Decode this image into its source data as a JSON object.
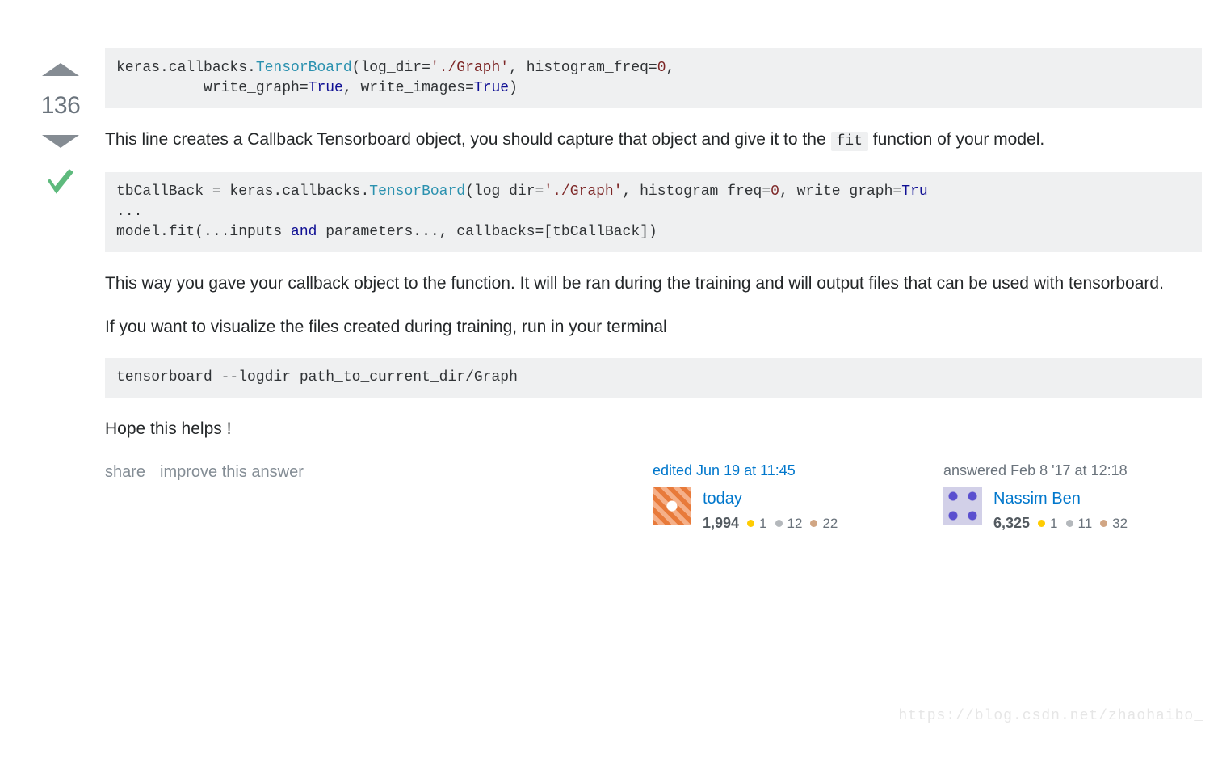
{
  "vote": {
    "count": "136"
  },
  "code": {
    "block1": {
      "prefix": "keras.callbacks.",
      "cls": "TensorBoard",
      "open": "(log_dir=",
      "str1": "'./Graph'",
      "mid1": ", histogram_freq=",
      "num1": "0",
      "mid2": ",  \n          write_graph=",
      "kw_true1": "True",
      "mid3": ", write_images=",
      "kw_true2": "True",
      "close": ")"
    },
    "block2": {
      "l1a": "tbCallBack = keras.callbacks.",
      "l1cls": "TensorBoard",
      "l1b": "(log_dir=",
      "l1str": "'./Graph'",
      "l1c": ", histogram_freq=",
      "l1num": "0",
      "l1d": ", write_graph=",
      "l1kw": "Tru",
      "l2": "...",
      "l3a": "model.fit(...inputs ",
      "l3kw": "and",
      "l3b": " parameters..., callbacks=[tbCallBack])"
    },
    "block3": "tensorboard --logdir path_to_current_dir/Graph"
  },
  "text": {
    "para1a": "This line creates a Callback Tensorboard object, you should capture that object and give it to the",
    "fit_code": "fit",
    "para1b": " function of your model.",
    "para2": "This way you gave your callback object to the function. It will be ran during the training and will output files that can be used with tensorboard.",
    "para3": "If you want to visualize the files created during training, run in your terminal",
    "para4": "Hope this helps !"
  },
  "actions": {
    "share": "share",
    "improve": "improve this answer"
  },
  "edit": {
    "prefix": "edited ",
    "time": "Jun 19 at 11:45",
    "user": "today",
    "rep": "1,994",
    "gold": "1",
    "silver": "12",
    "bronze": "22"
  },
  "author": {
    "prefix": "answered ",
    "time": "Feb 8 '17 at 12:18",
    "user": "Nassim Ben",
    "rep": "6,325",
    "gold": "1",
    "silver": "11",
    "bronze": "32"
  },
  "watermark": "https://blog.csdn.net/zhaohaibo_"
}
